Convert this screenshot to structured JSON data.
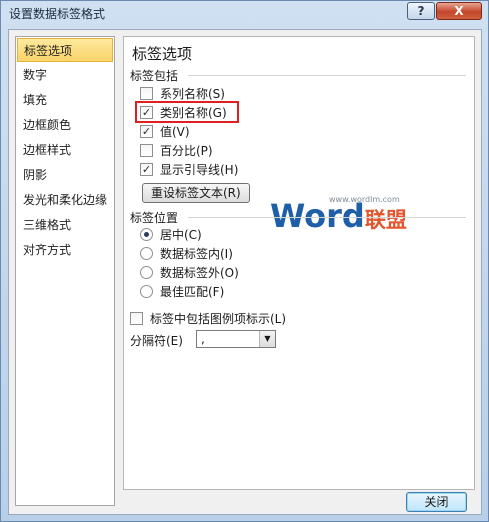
{
  "window": {
    "title": "设置数据标签格式",
    "help_label": "?",
    "close_glyph": "X"
  },
  "nav": {
    "items": [
      {
        "label": "标签选项",
        "selected": true
      },
      {
        "label": "数字"
      },
      {
        "label": "填充"
      },
      {
        "label": "边框颜色"
      },
      {
        "label": "边框样式"
      },
      {
        "label": "阴影"
      },
      {
        "label": "发光和柔化边缘"
      },
      {
        "label": "三维格式"
      },
      {
        "label": "对齐方式"
      }
    ]
  },
  "panel": {
    "heading": "标签选项",
    "contains_label": "标签包括",
    "checkboxes": [
      {
        "label": "系列名称(S)",
        "checked": false,
        "check_glyph": ""
      },
      {
        "label": "类别名称(G)",
        "checked": true,
        "check_glyph": "✓"
      },
      {
        "label": "值(V)",
        "checked": true,
        "check_glyph": "✓"
      },
      {
        "label": "百分比(P)",
        "checked": false,
        "check_glyph": ""
      },
      {
        "label": "显示引导线(H)",
        "checked": true,
        "check_glyph": "✓"
      }
    ],
    "reset_button": "重设标签文本(R)",
    "position_label": "标签位置",
    "positions": [
      {
        "label": "居中(C)",
        "selected": true
      },
      {
        "label": "数据标签内(I)",
        "selected": false
      },
      {
        "label": "数据标签外(O)",
        "selected": false
      },
      {
        "label": "最佳匹配(F)",
        "selected": false
      }
    ],
    "legend_key_label": "标签中包括图例项标示(L)",
    "legend_key_checked": false,
    "separator_label": "分隔符(E)",
    "separator_value": ",",
    "dropdown_arrow": "▼"
  },
  "watermark": {
    "url": "www.wordlm.com",
    "brand_latin": "Word",
    "brand_cn": "联盟"
  },
  "footer": {
    "close_button": "关闭"
  },
  "colors": {
    "highlight": "#e02020",
    "selected_nav": "#fbd46a",
    "watermark_blue": "#1f5fa8",
    "watermark_orange": "#e0562e"
  }
}
